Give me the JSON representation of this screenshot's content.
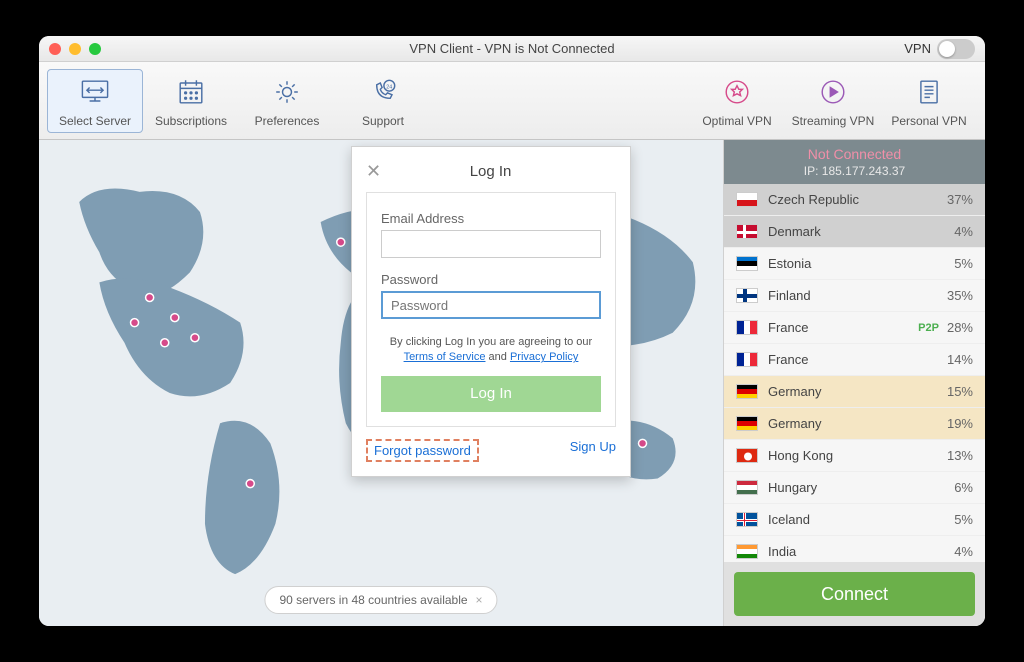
{
  "title": "VPN Client - VPN is Not Connected",
  "vpn_label": "VPN",
  "toolbar": {
    "select_server": "Select Server",
    "subscriptions": "Subscriptions",
    "preferences": "Preferences",
    "support": "Support",
    "optimal_vpn": "Optimal VPN",
    "streaming_vpn": "Streaming VPN",
    "personal_vpn": "Personal VPN"
  },
  "status": {
    "line1": "Not Connected",
    "line2": "IP: 185.177.243.37"
  },
  "servers": [
    {
      "flag": "cz",
      "name": "Czech Republic",
      "pct": "37%",
      "style": "hi1"
    },
    {
      "flag": "dk",
      "name": "Denmark",
      "pct": "4%",
      "style": "hi1"
    },
    {
      "flag": "ee",
      "name": "Estonia",
      "pct": "5%",
      "style": ""
    },
    {
      "flag": "fi",
      "name": "Finland",
      "pct": "35%",
      "style": ""
    },
    {
      "flag": "fr",
      "name": "France",
      "pct": "28%",
      "p2p": "P2P",
      "style": ""
    },
    {
      "flag": "fr",
      "name": "France",
      "pct": "14%",
      "style": ""
    },
    {
      "flag": "de",
      "name": "Germany",
      "pct": "15%",
      "style": "hi2"
    },
    {
      "flag": "de",
      "name": "Germany",
      "pct": "19%",
      "style": "hi2"
    },
    {
      "flag": "hk",
      "name": "Hong Kong",
      "pct": "13%",
      "style": ""
    },
    {
      "flag": "hu",
      "name": "Hungary",
      "pct": "6%",
      "style": ""
    },
    {
      "flag": "is",
      "name": "Iceland",
      "pct": "5%",
      "style": ""
    },
    {
      "flag": "in",
      "name": "India",
      "pct": "4%",
      "style": ""
    }
  ],
  "connect": "Connect",
  "badge": "90 servers in 48 countries available",
  "login": {
    "title": "Log In",
    "email_label": "Email Address",
    "password_label": "Password",
    "password_placeholder": "Password",
    "agree_pre": "By clicking Log In you are agreeing to our ",
    "tos": "Terms of Service",
    "and": " and ",
    "privacy": "Privacy Policy",
    "button": "Log In",
    "forgot": "Forgot password",
    "signup": "Sign Up"
  }
}
